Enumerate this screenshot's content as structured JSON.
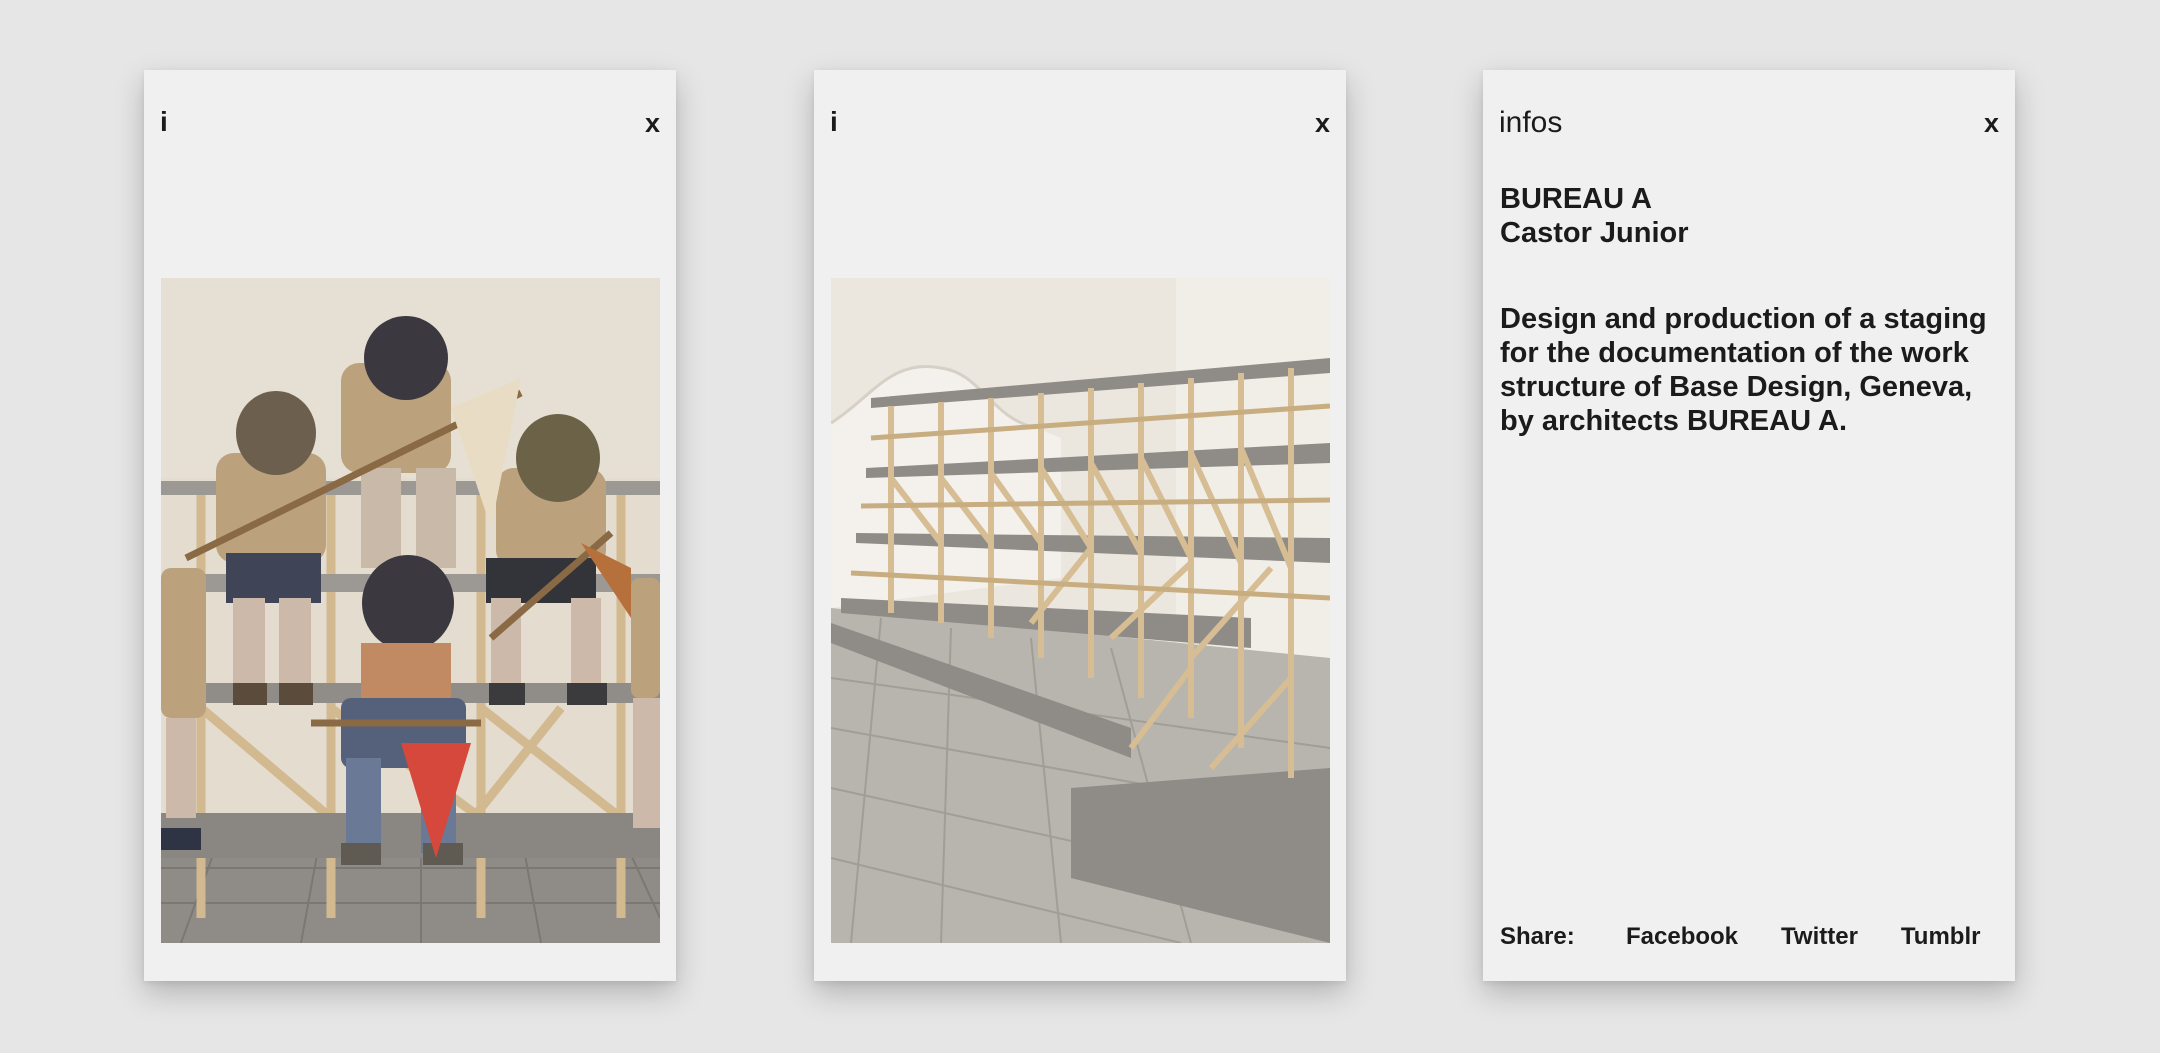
{
  "cards": [
    {
      "info_label": "i",
      "close_label": "x",
      "image": "scouts-on-wooden-bleachers-photo"
    },
    {
      "info_label": "i",
      "close_label": "x",
      "image": "empty-wooden-bleacher-structure-photo"
    },
    {
      "info_label": "infos",
      "close_label": "x",
      "title_line1": "BUREAU A",
      "title_line2": "Castor Junior",
      "description": "Design and production of a staging for the documentation of the work structure of Base Design, Geneva, by architects BUREAU A.",
      "share": {
        "label": "Share:",
        "links": [
          "Facebook",
          "Twitter",
          "Tumblr"
        ]
      }
    }
  ],
  "colors": {
    "background": "#e6e6e6",
    "card": "#f0f0f0",
    "text": "#1b1b1b",
    "wood": "#cdb58c",
    "bench": "#8d8b87",
    "pennant": "#d6483c"
  }
}
